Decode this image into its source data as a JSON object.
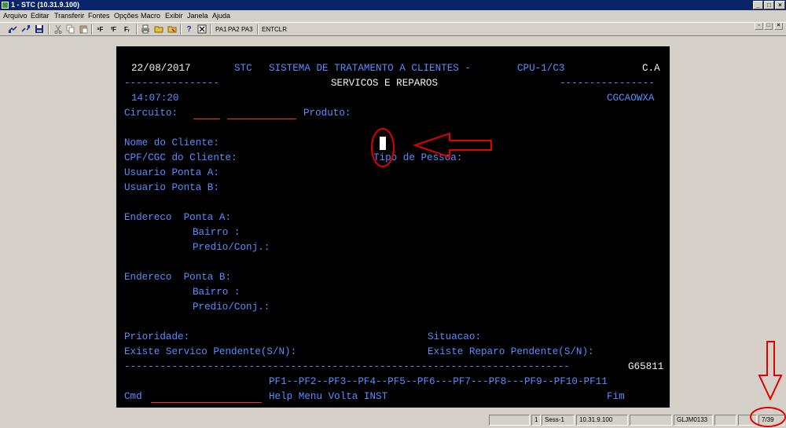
{
  "window": {
    "title": "1 - STC (10.31.9.100)",
    "minimize": "_",
    "maximize": "□",
    "close": "×",
    "doc_restore": "▫",
    "doc_close": "×"
  },
  "menu": [
    "Arquivo",
    "Editar",
    "Transferir",
    "Fontes",
    "Opções",
    "Macro",
    "Exibir",
    "Janela",
    "Ajuda"
  ],
  "toolbar": {
    "text_buttons": [
      "PA1",
      "PA2",
      "PA3",
      "ENT",
      "CLR"
    ],
    "icons": [
      "connect-icon",
      "disconnect-icon",
      "save-icon",
      "cut-icon",
      "copy-icon",
      "paste-icon",
      "font-size-icon",
      "font-larger-icon",
      "font-smaller-icon",
      "print-icon",
      "open-folder-icon",
      "save-folder-icon",
      "help-icon",
      "close-session-icon"
    ]
  },
  "terminal": {
    "date": "22/08/2017",
    "system_code": "STC",
    "system_name": "SISTEMA DE TRATAMENTO A CLIENTES -",
    "cpu": "CPU-1/C3",
    "top_right": "C.A",
    "dashes_left": "----------------",
    "screen_title": "SERVICOS E REPAROS",
    "dashes_right": "----------------",
    "time": "14:07:20",
    "program_id": "CGCAOWXA",
    "labels": {
      "circuito": "Circuito:",
      "produto": "Produto:",
      "nome_cliente": "Nome do Cliente:",
      "cpf_cgc": "CPF/CGC do Cliente:",
      "tipo_pessoa": "Tipo de Pessoa:",
      "usuario_a": "Usuario Ponta A:",
      "usuario_b": "Usuario Ponta B:",
      "endereco_a": "Endereco  Ponta A:",
      "bairro_a": "Bairro :",
      "predio_a": "Predio/Conj.:",
      "endereco_b": "Endereco  Ponta B:",
      "bairro_b": "Bairro :",
      "predio_b": "Predio/Conj.:",
      "prioridade": "Prioridade:",
      "situacao": "Situacao:",
      "servico_pendente": "Existe Servico Pendente(S/N):",
      "reparo_pendente": "Existe Reparo Pendente(S/N):"
    },
    "bottom_rule": "---------------------------------------------------------------------------",
    "screen_code": "G65811",
    "pf_keys": "PF1--PF2--PF3--PF4--PF5--PF6---PF7---PF8---PF9--PF10-PF11",
    "pf_actions": "Help Menu Volta INST",
    "pf_fim": "Fim",
    "cmd_label": "Cmd",
    "cmd_value": ""
  },
  "statusbar": {
    "session_number": "1",
    "session_name": "Sess-1",
    "host": "10.31.9.100",
    "lu_name": "GLJM0133",
    "cursor_pos": "7/39"
  },
  "colors": {
    "terminal_bg": "#000000",
    "field_text": "#5b8cff",
    "highlight_text": "#f2f2f2",
    "input_underline": "#ff2a2a",
    "annotation": "#e00000",
    "title_bar": "#0a246a"
  }
}
